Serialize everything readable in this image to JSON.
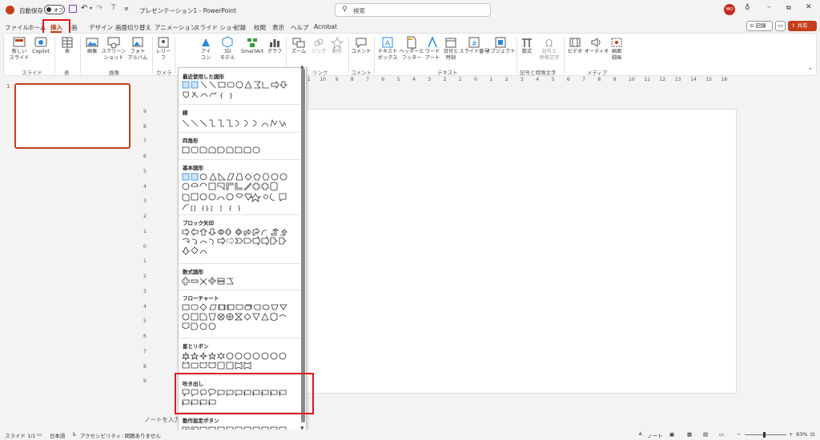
{
  "titlebar": {
    "autosave_label": "自動保存",
    "autosave_toggle": "オフ",
    "doc_title": "プレゼンテーション1  -  PowerPoint",
    "search_placeholder": "検索",
    "user_initials": "MO"
  },
  "tabs": [
    "ファイル",
    "ホーム",
    "挿入",
    "画",
    "デザイン",
    "画面切り替え",
    "アニメーション",
    "スライド ショー",
    "記録",
    "校閲",
    "表示",
    "ヘルプ",
    "Acrobat"
  ],
  "active_tab": "挿入",
  "right_buttons": {
    "record": "記録",
    "share": "共有"
  },
  "ribbon": {
    "slides": {
      "new_slide": "新しい\nスライド",
      "copilot": "Copilot",
      "group": "スライド"
    },
    "tables": {
      "table": "表",
      "group": "表"
    },
    "images": {
      "image": "画像",
      "screenshot": "スクリーン\nショット",
      "photo_album": "フォト\nアルバム",
      "group": "画像"
    },
    "camera": {
      "cameo": "レリー\nフ",
      "group": "カメラ"
    },
    "illustrations": {
      "icons": "アイ\nコン",
      "models3d": "3D\nモデル",
      "smartart": "SmartArt",
      "chart": "グラフ"
    },
    "links": {
      "zoom": "ズーム",
      "link": "リンク",
      "action": "動作",
      "group": "リンク"
    },
    "comments": {
      "comment": "コメント",
      "group": "コメント"
    },
    "text": {
      "textbox": "テキスト\nボックス",
      "header": "ヘッダーと\nフッター",
      "wordart": "ワード\nアート",
      "datetime": "日付と\n時刻",
      "slide_number": "スライド番号",
      "object": "オブジェクト",
      "group": "テキスト"
    },
    "symbols": {
      "equation": "数式",
      "symbol": "記号と\n特殊文字",
      "group": "記号と特殊文字"
    },
    "media": {
      "video": "ビデオ",
      "audio": "オーディオ",
      "screen_recording": "画面\n録画",
      "group": "メディア"
    }
  },
  "shapes_gallery": {
    "sections": [
      {
        "title": "最近使用した図形"
      },
      {
        "title": "線"
      },
      {
        "title": "四角形"
      },
      {
        "title": "基本図形"
      },
      {
        "title": "ブロック矢印"
      },
      {
        "title": "数式図形"
      },
      {
        "title": "フローチャート"
      },
      {
        "title": "星とリボン"
      },
      {
        "title": "吹き出し"
      },
      {
        "title": "動作設定ボタン"
      }
    ],
    "highlighted_section": "吹き出し"
  },
  "slide_panel": {
    "slide_number": "1"
  },
  "ruler_labels": [
    "11",
    "10",
    "9",
    "8",
    "7",
    "6",
    "5",
    "4",
    "3",
    "2",
    "1",
    "0",
    "1",
    "2",
    "3",
    "4",
    "5",
    "6",
    "7",
    "8",
    "9",
    "10",
    "11",
    "12",
    "13",
    "14",
    "15",
    "16"
  ],
  "vruler_labels": [
    "9",
    "8",
    "7",
    "6",
    "5",
    "4",
    "3",
    "2",
    "1",
    "0",
    "1",
    "2",
    "3",
    "4",
    "5",
    "6",
    "7",
    "8",
    "9"
  ],
  "notes_placeholder": "ノートを入力",
  "statusbar": {
    "slide_info": "スライド 1/1",
    "language": "日本語",
    "accessibility": "アクセシビリティ: 問題ありません",
    "notes": "ノート",
    "zoom": "93%"
  },
  "colors": {
    "accent": "#c43e1c",
    "highlight": "#e0141e",
    "share_bg": "#c43e1c"
  }
}
